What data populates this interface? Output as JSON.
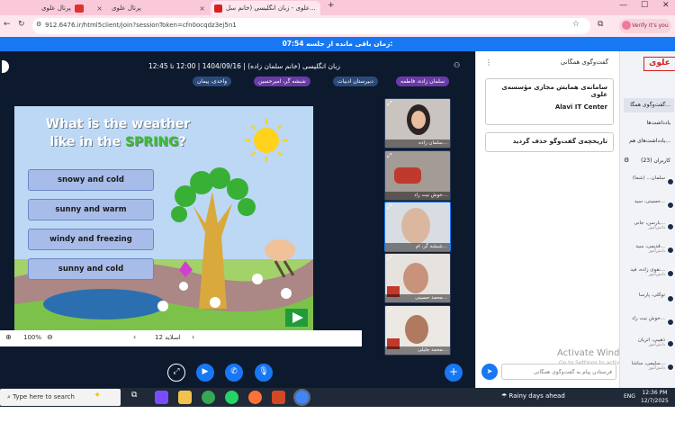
{
  "browser": {
    "tabs": [
      {
        "title": "پرتال علوی",
        "icon": "alavi-icon"
      },
      {
        "title": "پرتال علوی",
        "icon": "alavi-icon"
      },
      {
        "title": "علوی - زبان انگلیسی (خانم سل...",
        "icon": "classroom-icon"
      }
    ],
    "new_tab": "+",
    "url": "912.6476.ir/html5client/join?sessionToken=cfn0ocqdz3ej5n1",
    "verify_label": "Verify it's you"
  },
  "timer": {
    "label": "زمان باقی مانده از جلسه:",
    "value": "07:54"
  },
  "meeting": {
    "title": "زبان انگلیسی (خانم سلمان زاده) | 1404/09/16 | 12:00 تا 12:45",
    "chips": [
      "سلمان زاده، فاطمه",
      "دبیرستان ادبیات",
      "شبشه گر، امیرحسین",
      "واحدی، پیمان"
    ]
  },
  "slide": {
    "title_line1": "What is the weather",
    "title_line2_prefix": "like in the ",
    "title_line2_highlight": "SPRING",
    "title_line2_suffix": "?",
    "options": [
      "snowy and cold",
      "sunny and warm",
      "windy and freezing",
      "sunny and cold"
    ],
    "toolbar": {
      "zoom": "100%",
      "slide_label": "اسلاید 12"
    }
  },
  "video_tiles": [
    {
      "name": "سلمان زاده..."
    },
    {
      "name": "خوش نیت راد..."
    },
    {
      "name": "شبشه گر، ام..."
    },
    {
      "name": "محمد حسینی..."
    },
    {
      "name": "محمد جلیلی..."
    }
  ],
  "controls": [
    "share-screen-icon",
    "camera-icon",
    "phone-icon",
    "microphone-icon"
  ],
  "chat": {
    "header": "گفت‌وگوی همگانی",
    "welcome_line1": "سامانه‌ی همایش مجازی مؤسسه‌ی علوی",
    "welcome_line2": "Alavi IT Center",
    "cleared": "تاریخچه‌ی گفت‌وگو حذف گردید",
    "input_placeholder": "فرستادن پیام به گفت‌وگوی همگانی",
    "activate_line1": "Activate Windows",
    "activate_line2": "Go to Settings to activate Windows."
  },
  "people": {
    "logo": "علوی",
    "public_chat": "گفت‌وگوی همگا...",
    "notes": "یادداشت‌ها",
    "shared_notes": "یادداشت‌های هم...",
    "users_label": "کاربران (23)",
    "users": [
      {
        "name": "سلمان... (شما)",
        "role": ""
      },
      {
        "name": "حسینی، سید...",
        "role": ""
      },
      {
        "name": "بارسن، جانی...",
        "role": "دانش‌آموز"
      },
      {
        "name": "قدیمی، سید...",
        "role": "دانش‌آموز"
      },
      {
        "name": "نقوی زاده، فید...",
        "role": "دانش‌آموز"
      },
      {
        "name": "توکلی، پارسا",
        "role": ""
      },
      {
        "name": "خوش نیت راد...",
        "role": ""
      },
      {
        "name": "ذهیبی، آتریان",
        "role": "دانش‌آموز"
      },
      {
        "name": "سلیمی، ساشا...",
        "role": "دانش‌آموز"
      }
    ]
  },
  "taskbar": {
    "search": "Type here to search",
    "weather": "Rainy days ahead",
    "lang": "ENG",
    "time": "12:36 PM",
    "date": "12/7/2025"
  }
}
